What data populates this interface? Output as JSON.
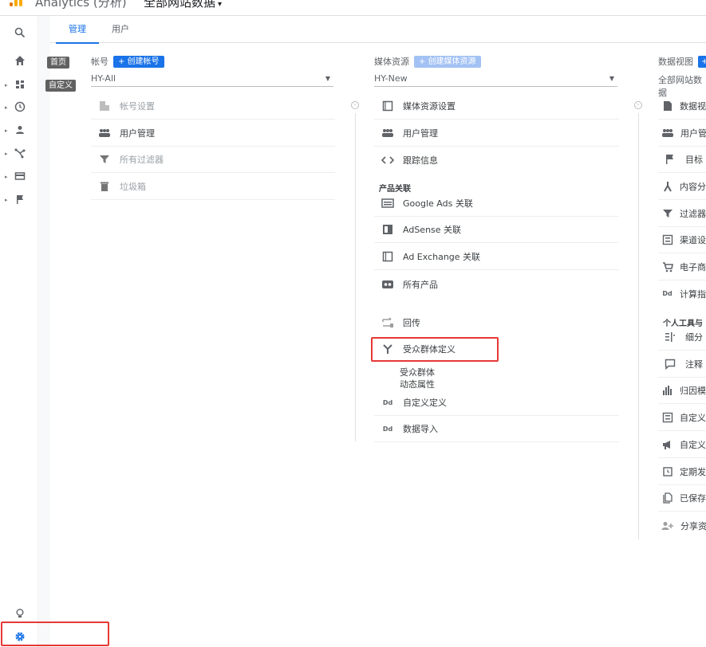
{
  "header": {
    "app_title": "Analytics (分析)",
    "property_title": "全部网站数据",
    "caret": "▾"
  },
  "rail": {
    "items": [
      "search-icon",
      "home-icon",
      "dashboard-icon",
      "clock-icon",
      "person-icon",
      "acquisition-icon",
      "behavior-icon",
      "flag-icon"
    ],
    "bottom": [
      "lightbulb-icon",
      "gear-icon"
    ]
  },
  "tabs": {
    "admin": "管理",
    "user": "用户"
  },
  "tooltips": {
    "home": "首页",
    "custom": "自定义"
  },
  "account": {
    "label": "帐号",
    "create": "+ 创建帐号",
    "selected": "HY-All",
    "items": [
      {
        "label": "帐号设置",
        "icon": "building-icon"
      },
      {
        "label": "用户管理",
        "icon": "people-icon"
      },
      {
        "label": "所有过滤器",
        "icon": "filter-icon"
      },
      {
        "label": "垃圾箱",
        "icon": "trash-icon"
      }
    ]
  },
  "property": {
    "label": "媒体资源",
    "create": "+ 创建媒体资源",
    "selected": "HY-New",
    "items": [
      {
        "label": "媒体资源设置",
        "icon": "square-icon"
      },
      {
        "label": "用户管理",
        "icon": "people-icon"
      },
      {
        "label": "跟踪信息",
        "icon": "code-icon"
      }
    ],
    "product_section": "产品关联",
    "products": [
      {
        "label": "Google Ads 关联",
        "icon": "ads-icon"
      },
      {
        "label": "AdSense 关联",
        "icon": "adsense-icon"
      },
      {
        "label": "Ad Exchange 关联",
        "icon": "adx-icon"
      },
      {
        "label": "所有产品",
        "icon": "all-products-icon"
      }
    ],
    "postbacks": "回传",
    "audience": "受众群体定义",
    "audience_subs": [
      "受众群体",
      "动态属性"
    ],
    "custom_def": "自定义定义",
    "data_import": "数据导入"
  },
  "view": {
    "label": "数据视图",
    "selected": "全部网站数据",
    "items": [
      "数据视",
      "用户管",
      "目标",
      "内容分",
      "过滤器",
      "渠道设",
      "电子商",
      "计算指"
    ],
    "personal_section": "个人工具与",
    "personal": [
      "细分",
      "注释",
      "归因模",
      "自定义",
      "自定义",
      "定期发",
      "已保存",
      "分享资"
    ]
  }
}
